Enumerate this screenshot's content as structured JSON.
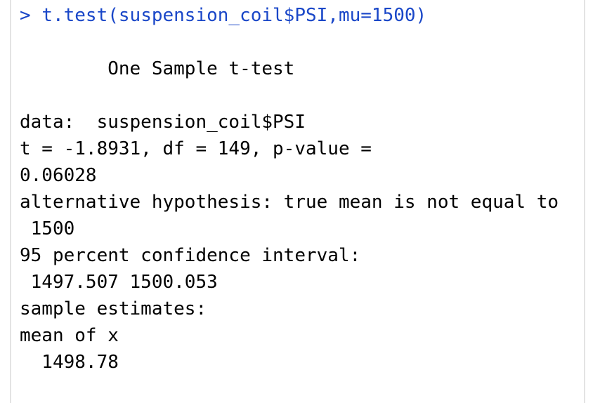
{
  "console": {
    "prompt": ">",
    "command": "t.test(suspension_coil$PSI,mu=1500)",
    "output": {
      "title": "        One Sample t-test",
      "data_line": "data:  suspension_coil$PSI",
      "stats_line": "t = -1.8931, df = 149, p-value =",
      "pvalue_line": "0.06028",
      "alt_line": "alternative hypothesis: true mean is not equal to",
      "alt_value_line": " 1500",
      "ci_label": "95 percent confidence interval:",
      "ci_values": " 1497.507 1500.053",
      "estimates_label": "sample estimates:",
      "estimates_header": "mean of x",
      "estimates_value": "  1498.78"
    }
  },
  "colors": {
    "command": "#1a47c8",
    "output": "#000000",
    "background": "#ffffff",
    "border": "#e3e3e3"
  }
}
